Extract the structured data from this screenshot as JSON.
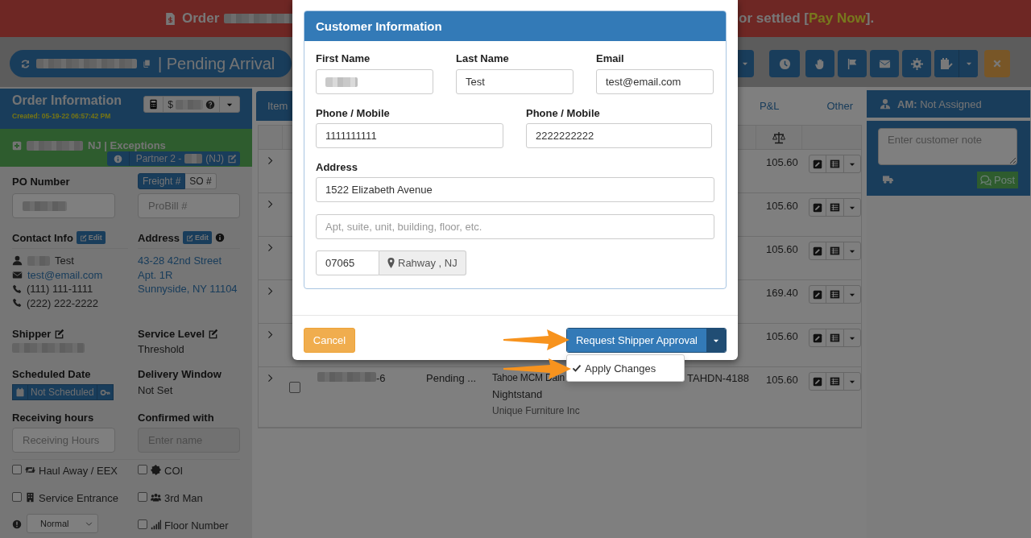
{
  "banner": {
    "lead": "Order",
    "tail_before": "or settled [",
    "link": "Pay Now",
    "tail_after": "]."
  },
  "title_bar": {
    "status": "| Pending Arrival"
  },
  "order_panel": {
    "title": "Order Information",
    "created": "Created: 05-19-22 06:57:42 PM",
    "price_prefix": "$",
    "group": "NJ | Exceptions",
    "partner": "Partner 2 -",
    "partner_suffix": "(NJ)"
  },
  "po": {
    "label": "PO Number"
  },
  "number_tabs": [
    {
      "label": "Freight #",
      "selected": true
    },
    {
      "label": "SO #",
      "selected": false
    }
  ],
  "probill": {
    "placeholder": "ProBill #"
  },
  "contact": {
    "label": "Contact Info",
    "edit": "Edit",
    "name": "Test",
    "email": "test@email.com",
    "phones": [
      "(111) 111-1111",
      "(222) 222-2222"
    ]
  },
  "address": {
    "label": "Address",
    "edit": "Edit",
    "lines": [
      "43-28 42nd Street",
      "Apt. 1R",
      "Sunnyside, NY 11104"
    ]
  },
  "shipper": {
    "label": "Shipper"
  },
  "service_level": {
    "label": "Service Level",
    "value": "Threshold"
  },
  "scheduled_date": {
    "label": "Scheduled Date",
    "value": "Not Scheduled"
  },
  "delivery_window": {
    "label": "Delivery Window",
    "value": "Not Set"
  },
  "receiving_hours": {
    "label": "Receiving hours",
    "placeholder": "Receiving Hours"
  },
  "confirmed_with": {
    "label": "Confirmed with",
    "placeholder": "Enter name",
    "disabled": true
  },
  "options": [
    {
      "label": "Haul Away / EEX",
      "checked": false
    },
    {
      "label": "COI",
      "checked": false
    },
    {
      "label": "Service Entrance",
      "checked": false
    },
    {
      "label": "3rd Man",
      "checked": false
    },
    {
      "label": "Floor Number",
      "checked": false
    }
  ],
  "priority": {
    "value": "Normal"
  },
  "item_tabs": [
    {
      "label": "Item",
      "selected": true
    },
    {
      "label": "P&L",
      "selected": false
    },
    {
      "label": "Other",
      "selected": false
    }
  ],
  "items": [
    {
      "amount": "105.60"
    },
    {
      "amount": "105.60"
    },
    {
      "amount": "105.60"
    },
    {
      "amount": "169.40"
    },
    {
      "amount": "105.60"
    },
    {
      "checked": false,
      "id_suffix": "-6",
      "status": "Pending ...",
      "product": "Tahoe MCM Dain",
      "sku": "TAHDN-4188",
      "name": "Nightstand",
      "vendor": "Unique Furniture Inc",
      "amount": "105.60"
    }
  ],
  "am_panel": {
    "title": "**AM:** Not Assigned"
  },
  "note": {
    "placeholder": "Enter customer note",
    "post": "Post"
  },
  "modal": {
    "title": "Customer Information",
    "first_name": {
      "label": "First Name",
      "redacted": true
    },
    "last_name": {
      "label": "Last Name",
      "value": "Test"
    },
    "email": {
      "label": "Email",
      "value": "test@email.com"
    },
    "phones": [
      {
        "label": "Phone / Mobile",
        "value": "1111111111"
      },
      {
        "label": "Phone / Mobile",
        "value": "2222222222"
      }
    ],
    "address": {
      "label": "Address",
      "line1": "1522 Elizabeth Avenue",
      "line2_placeholder": "Apt, suite, unit, building, floor, etc.",
      "zip": "07065",
      "city": "Rahway , NJ"
    },
    "cancel": "Cancel",
    "submit": "Request Shipper Approval",
    "menu_item": "Apply Changes"
  }
}
